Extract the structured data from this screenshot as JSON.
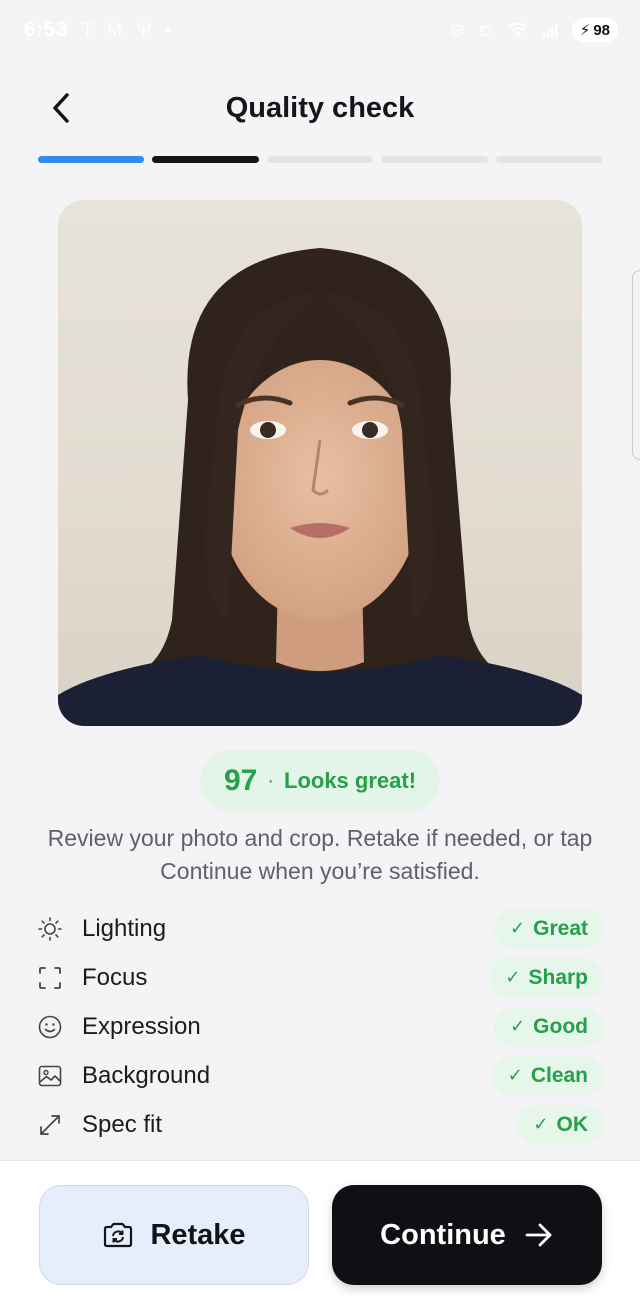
{
  "status_bar": {
    "time": "6:53",
    "battery": "98",
    "icons": [
      "text-t-icon",
      "mail-icon",
      "usb-icon",
      "dot-icon",
      "dnd-icon",
      "car-icon",
      "wifi-icon",
      "signal-icon",
      "bolt-icon"
    ]
  },
  "header": {
    "title": "Quality check",
    "back_icon": "chevron-left-icon"
  },
  "progress": {
    "total_steps": 5,
    "segments": [
      "complete-blue",
      "current-dark",
      "pending",
      "pending",
      "pending"
    ],
    "colors": {
      "blue": "#2f8df0",
      "dark": "#141518",
      "pending": "#e3e4e8"
    }
  },
  "photo": {
    "subject": "portrait-photo"
  },
  "score": {
    "value": "97",
    "separator": "·",
    "label": "Looks great!",
    "color": "#27a04a"
  },
  "instructions": "Review your photo and crop. Retake if needed, or tap Continue when you’re satisfied.",
  "checks": [
    {
      "label": "Lighting",
      "icon": "sun-icon",
      "status": "Great",
      "mark": "✓"
    },
    {
      "label": "Focus",
      "icon": "focus-frame-icon",
      "status": "Sharp",
      "mark": "✓"
    },
    {
      "label": "Expression",
      "icon": "smile-icon",
      "status": "Good",
      "mark": "✓"
    },
    {
      "label": "Background",
      "icon": "image-icon",
      "status": "Clean",
      "mark": "✓"
    },
    {
      "label": "Spec fit",
      "icon": "resize-icon",
      "status": "OK",
      "mark": "✓"
    }
  ],
  "actions": {
    "retake_label": "Retake",
    "retake_icon": "camera-rotate-icon",
    "continue_label": "Continue",
    "continue_icon": "arrow-right-icon"
  }
}
